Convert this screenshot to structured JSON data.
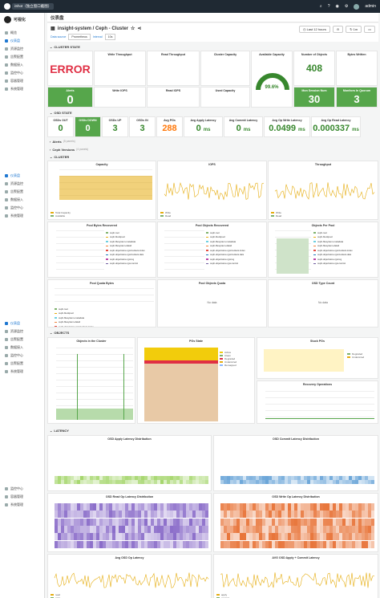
{
  "topbar": {
    "tip": "iShot（独立窗口截图）",
    "icons": [
      "search-icon",
      "help-icon",
      "bell-icon",
      "settings-icon"
    ],
    "user": "admin"
  },
  "sidebar": {
    "brand": "可视化",
    "groups": [
      {
        "items": [
          "概览",
          "仪表盘",
          "资源监控",
          "告警配置",
          "数据接入",
          "监控中心",
          "容器管理",
          "系统管理"
        ],
        "active": 1
      },
      {
        "items": [
          "仪表盘",
          "资源监控",
          "告警配置",
          "数据接入",
          "监控中心",
          "系统管理"
        ],
        "active": 0
      },
      {
        "items": [
          "仪表盘",
          "资源监控",
          "告警配置",
          "数据接入",
          "监控中心",
          "告警配置",
          "系统管理"
        ],
        "active": 0
      },
      {
        "items": [
          "监控中心",
          "容器管理",
          "系统管理"
        ],
        "active": -1
      }
    ]
  },
  "breadcrumb": "仪表盘",
  "dashboard": {
    "title": "insight-system / Ceph - Cluster",
    "time_range": "Last 12 hours",
    "refresh": "1m",
    "vars": [
      {
        "label": "Data source",
        "value": "Prometheus"
      },
      {
        "label": "Interval",
        "value": "10s"
      }
    ]
  },
  "rows": {
    "cluster_state": "CLUSTER STATE",
    "osd_state": "OSD STATE",
    "alerts": "Alerts",
    "alerts_count": "(5 panels)",
    "ceph_versions": "Ceph Versions",
    "ceph_versions_count": "(4 panels)",
    "cluster": "CLUSTER",
    "objects": "OBJECTS",
    "latency": "LATENCY"
  },
  "cluster_state": {
    "status": {
      "value": "ERROR"
    },
    "alerts": {
      "label": "Alerts",
      "value": "0"
    },
    "write_throughput": "Write Throughput",
    "read_throughput": "Read Throughput",
    "write_iops": "Write IOPS",
    "read_iops": "Read IOPS",
    "cluster_capacity": "Cluster Capacity",
    "used_capacity": "Used Capacity",
    "available_capacity": {
      "label": "Available Capacity",
      "value": "99.6%",
      "fraction": 0.996
    },
    "num_objects": {
      "label": "Number of Objects",
      "value": "408"
    },
    "bytes_written": "Bytes Written",
    "bytes_read": "Bytes Read",
    "mon_session": {
      "label": "Mon Session Num",
      "value": "30"
    },
    "monitors_quorum": {
      "label": "Monitors In Quorum",
      "value": "3"
    }
  },
  "osd_state": [
    {
      "label": "OSDs OUT",
      "value": "0",
      "style": "green"
    },
    {
      "label": "OSDs DOWN",
      "value": "0",
      "style": "gbox"
    },
    {
      "label": "OSDs UP",
      "value": "3",
      "style": "green"
    },
    {
      "label": "OSDs IN",
      "value": "3",
      "style": "green"
    },
    {
      "label": "Avg PGs",
      "value": "288",
      "style": "orange"
    },
    {
      "label": "Avg Apply Latency",
      "value": "0",
      "unit": "ms",
      "style": "green"
    },
    {
      "label": "Avg Commit Latency",
      "value": "0",
      "unit": "ms",
      "style": "green"
    },
    {
      "label": "Avg Op Write Latency",
      "value": "0.0499",
      "unit": "ms",
      "style": "green"
    },
    {
      "label": "Avg Op Read Latency",
      "value": "0.000337",
      "unit": "ms",
      "style": "green"
    }
  ],
  "cluster_panels": {
    "capacity": {
      "title": "Capacity",
      "series": [
        "Total Capacity",
        "Available"
      ],
      "color_total": "#e5ac0e",
      "color_avail": "#7eb26d"
    },
    "iops": {
      "title": "IOPS",
      "series": [
        "Write",
        "Read"
      ]
    },
    "throughput": {
      "title": "Throughput",
      "series": [
        "Write",
        "Read"
      ]
    },
    "pool_bytes_recovered": "Pool Bytes Recovered",
    "pool_objects_recovered": "Pool Objects Recovered",
    "objects_per_pool": "Objects Per Pool",
    "pool_quota_bytes": "Pool Quota Bytes",
    "pool_objects_quota": "Pool Objects Quota",
    "osd_type_count": "OSD Type Count",
    "no_data": "No data",
    "pools": [
      "ceph-root",
      "ceph-blockpool",
      "ceph-filesystem-metadata",
      "ceph-filesystem-data0",
      "ceph-objectstore.rgw.buckets.index",
      "ceph-objectstore.rgw.buckets.data",
      "ceph-objectstore.rgw.log",
      "ceph-objectstore.rgw.control"
    ]
  },
  "objects_panels": {
    "objects_in_cluster": "Objects in the Cluster",
    "pgs_state": {
      "title": "PGs State",
      "legend": [
        "Active",
        "Clean",
        "Degraded",
        "Undersized",
        "Remapped"
      ]
    },
    "stuck_pgs": {
      "title": "Stuck PGs",
      "legend": [
        "Degraded",
        "Undersized"
      ]
    },
    "recovery_ops": "Recovery Operations"
  },
  "latency_panels": {
    "apply_dist": "OSD Apply Latency Distribution",
    "commit_dist": "OSD Commit Latency Distribution",
    "read_dist": "OSD Read Op Latency Distribution",
    "write_dist": "OSD Write Op Latency Distribution",
    "avg_osd": {
      "title": "Avg OSD Op Latency",
      "legend": [
        "read",
        "write"
      ]
    },
    "avg_apply_commit": {
      "title": "AVG OSD Apply + Commit Latency",
      "legend": [
        "apply",
        "commit"
      ]
    }
  }
}
